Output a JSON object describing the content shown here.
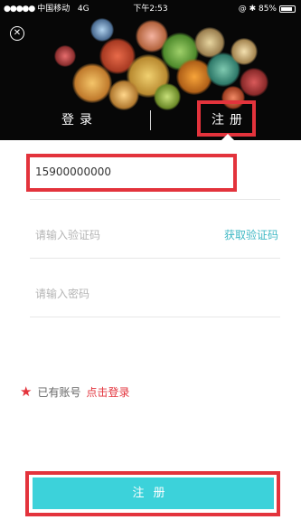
{
  "status_bar": {
    "carrier": "中国移动",
    "network": "4G",
    "time": "下午2:53",
    "battery": "85%"
  },
  "header": {
    "close_icon": "close-circle-icon",
    "tabs": [
      {
        "label": "登录",
        "active": false
      },
      {
        "label": "注册",
        "active": true
      }
    ]
  },
  "form": {
    "phone_value": "15900000000",
    "code_placeholder": "请输入验证码",
    "get_code_label": "获取验证码",
    "password_placeholder": "请输入密码"
  },
  "footer": {
    "has_account_label": "已有账号",
    "login_link": "点击登录"
  },
  "submit_label": "注册",
  "colors": {
    "accent": "#3cd2da",
    "link": "#3fb8c4",
    "highlight": "#e3333c"
  }
}
